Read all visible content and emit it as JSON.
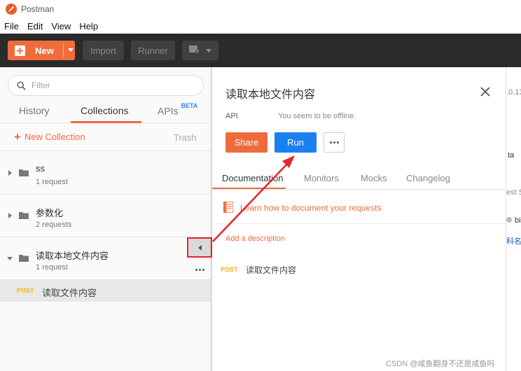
{
  "app": {
    "title": "Postman"
  },
  "menu": [
    "File",
    "Edit",
    "View",
    "Help"
  ],
  "toolbar": {
    "new_label": "New",
    "import_label": "Import",
    "runner_label": "Runner"
  },
  "sidebar": {
    "filter_placeholder": "Filter",
    "tabs": {
      "history": "History",
      "collections": "Collections",
      "apis": "APIs",
      "apis_badge": "BETA"
    },
    "new_collection": "New Collection",
    "trash": "Trash",
    "collections": [
      {
        "name": "ss",
        "count": "1 request"
      },
      {
        "name": "参数化",
        "count": "2 requests"
      },
      {
        "name": "读取本地文件内容",
        "count": "1 request"
      }
    ],
    "request": {
      "method": "POST",
      "name": "读取文件内容"
    }
  },
  "panel": {
    "title": "读取本地文件内容",
    "api_label": "API",
    "offline_text": "You seem to be offline.",
    "share_label": "Share",
    "run_label": "Run",
    "tabs": [
      "Documentation",
      "Monitors",
      "Mocks",
      "Changelog"
    ],
    "learn_link": "Learn how to document your requests",
    "add_description": "Add a description",
    "request": {
      "method": "POST",
      "name": "读取文件内容"
    }
  },
  "right_pane": {
    "frag1": ".0.13",
    "frag2": "ta",
    "frag3": "est S",
    "frag4": "bi",
    "frag5": "科名"
  },
  "watermark": "CSDN @咸鱼翻身不还是咸鱼吗",
  "colors": {
    "accent": "#f26b3a",
    "run_blue": "#1a7ff0",
    "toolbar_bg": "#2b2b2b",
    "annotation_red": "#e8232a"
  }
}
